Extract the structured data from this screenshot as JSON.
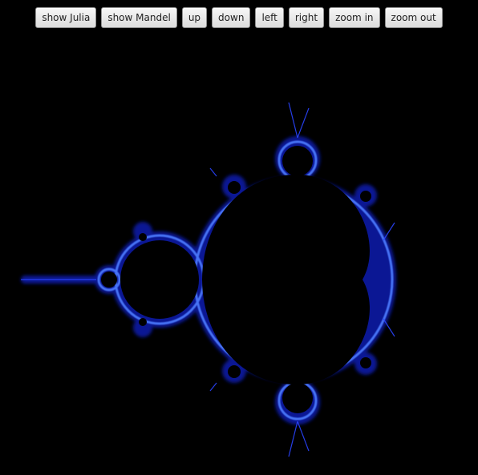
{
  "toolbar": {
    "buttons": [
      {
        "id": "show-julia",
        "label": "show Julia"
      },
      {
        "id": "show-mandel",
        "label": "show Mandel"
      },
      {
        "id": "up",
        "label": "up"
      },
      {
        "id": "down",
        "label": "down"
      },
      {
        "id": "left",
        "label": "left"
      },
      {
        "id": "right",
        "label": "right"
      },
      {
        "id": "zoom-in",
        "label": "zoom in"
      },
      {
        "id": "zoom-out",
        "label": "zoom out"
      }
    ]
  },
  "fractal": {
    "type": "Mandelbrot set",
    "background_color": "#000000",
    "edge_color": "#1a2fd8",
    "glow_color": "#6fa2ff"
  }
}
